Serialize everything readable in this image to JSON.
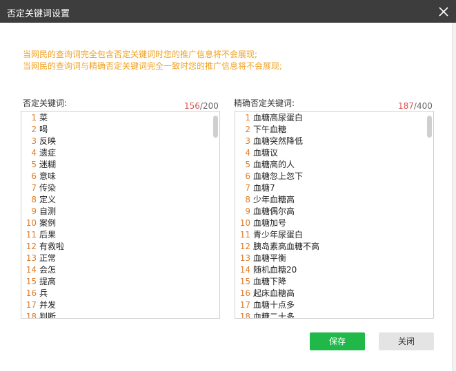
{
  "dialog": {
    "title": "否定关键词设置",
    "notice": [
      "当网民的查询词完全包含否定关键词时您的推广信息将不会展现;",
      "当网民的查询词与精确否定关键词完全一致时您的推广信息将不会展现;"
    ]
  },
  "negative": {
    "label": "否定关键词:",
    "count": "156",
    "sep": "/",
    "max": "200",
    "items": [
      {
        "n": "1",
        "t": "菜"
      },
      {
        "n": "2",
        "t": "喝"
      },
      {
        "n": "3",
        "t": "反映"
      },
      {
        "n": "4",
        "t": "遗症"
      },
      {
        "n": "5",
        "t": "迷糊"
      },
      {
        "n": "6",
        "t": "意味"
      },
      {
        "n": "7",
        "t": "传染"
      },
      {
        "n": "8",
        "t": "定义"
      },
      {
        "n": "9",
        "t": "自测"
      },
      {
        "n": "10",
        "t": "案例"
      },
      {
        "n": "11",
        "t": "后果"
      },
      {
        "n": "12",
        "t": "有救啦"
      },
      {
        "n": "13",
        "t": "正常"
      },
      {
        "n": "14",
        "t": "会怎"
      },
      {
        "n": "15",
        "t": "提高"
      },
      {
        "n": "16",
        "t": "兵"
      },
      {
        "n": "17",
        "t": "并发"
      },
      {
        "n": "18",
        "t": "判断"
      }
    ]
  },
  "exact": {
    "label": "精确否定关键词:",
    "count": "187",
    "sep": "/",
    "max": "400",
    "items": [
      {
        "n": "1",
        "t": "血糖高尿蛋白"
      },
      {
        "n": "2",
        "t": "下午血糖"
      },
      {
        "n": "3",
        "t": "血糖突然降低"
      },
      {
        "n": "4",
        "t": "血糖议"
      },
      {
        "n": "5",
        "t": "血糖高的人"
      },
      {
        "n": "6",
        "t": "血糖忽上忽下"
      },
      {
        "n": "7",
        "t": "血糖7"
      },
      {
        "n": "8",
        "t": "少年血糖高"
      },
      {
        "n": "9",
        "t": "血糖偶尔高"
      },
      {
        "n": "10",
        "t": "血糖加号"
      },
      {
        "n": "11",
        "t": "青少年尿蛋白"
      },
      {
        "n": "12",
        "t": "胰岛素高血糖不高"
      },
      {
        "n": "13",
        "t": "血糖平衡"
      },
      {
        "n": "14",
        "t": "随机血糖20"
      },
      {
        "n": "15",
        "t": "血糖下降"
      },
      {
        "n": "16",
        "t": "起床血糖高"
      },
      {
        "n": "17",
        "t": "血糖十点多"
      },
      {
        "n": "18",
        "t": "血糖二十多"
      }
    ]
  },
  "buttons": {
    "save": "保存",
    "close": "关闭"
  }
}
